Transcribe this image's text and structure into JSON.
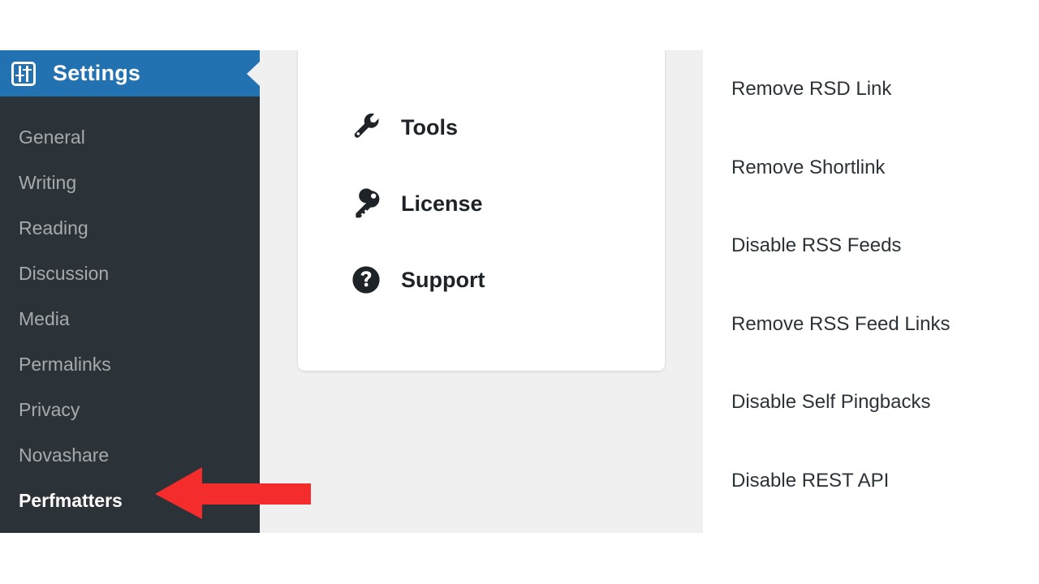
{
  "colors": {
    "sidebar_bg": "#2c3338",
    "sidebar_header_bg": "#2271b1",
    "content_bg": "#f0f0f1",
    "card_bg": "#ffffff",
    "text_dark": "#1d2327",
    "text_muted": "#a7aaad",
    "annotation_red": "#f42c2c"
  },
  "sidebar": {
    "header": {
      "title": "Settings",
      "icon": "settings-sliders-icon"
    },
    "items": [
      {
        "label": "General",
        "current": false
      },
      {
        "label": "Writing",
        "current": false
      },
      {
        "label": "Reading",
        "current": false
      },
      {
        "label": "Discussion",
        "current": false
      },
      {
        "label": "Media",
        "current": false
      },
      {
        "label": "Permalinks",
        "current": false
      },
      {
        "label": "Privacy",
        "current": false
      },
      {
        "label": "Novashare",
        "current": false
      },
      {
        "label": "Perfmatters",
        "current": true
      }
    ]
  },
  "nav_card": {
    "items": [
      {
        "label": "Tools",
        "icon": "wrench-icon"
      },
      {
        "label": "License",
        "icon": "key-icon"
      },
      {
        "label": "Support",
        "icon": "question-circle-icon"
      }
    ]
  },
  "options": {
    "items": [
      {
        "label": "Remove RSD Link"
      },
      {
        "label": "Remove Shortlink"
      },
      {
        "label": "Disable RSS Feeds"
      },
      {
        "label": "Remove RSS Feed Links"
      },
      {
        "label": "Disable Self Pingbacks"
      },
      {
        "label": "Disable REST API"
      }
    ]
  },
  "annotation": {
    "type": "arrow-left",
    "color": "#f42c2c",
    "points_at": "Perfmatters"
  }
}
